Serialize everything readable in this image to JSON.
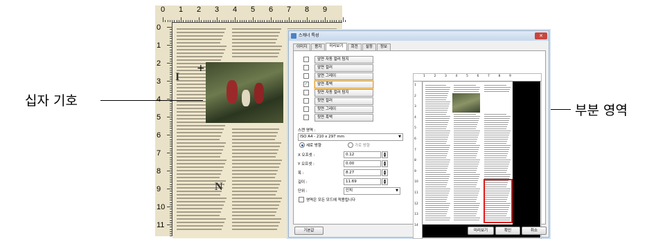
{
  "callouts": {
    "crosshair_label": "십자 기호",
    "region_label": "부분 영역"
  },
  "ruler": {
    "top_numbers": [
      "0",
      "1",
      "2",
      "3",
      "4",
      "5",
      "6",
      "7",
      "8",
      "9"
    ],
    "left_numbers": [
      "0",
      "1",
      "2",
      "3",
      "4",
      "5",
      "6",
      "7",
      "8",
      "9",
      "10",
      "11"
    ]
  },
  "dialog": {
    "title": "스캐너 특성",
    "close_label": "✕",
    "tabs": [
      "이미지",
      "용지",
      "미리보기",
      "회전",
      "설정",
      "정보"
    ],
    "active_tab": "미리보기",
    "options": [
      {
        "label": "앞면 자동 컬러 탐지",
        "checked": false
      },
      {
        "label": "앞면 컬러",
        "checked": false
      },
      {
        "label": "앞면 그레이",
        "checked": false
      },
      {
        "label": "앞면 흑백",
        "checked": true
      },
      {
        "label": "뒷면 자동 컬러 탐지",
        "checked": false
      },
      {
        "label": "뒷면 컬러",
        "checked": false
      },
      {
        "label": "뒷면 그레이",
        "checked": false
      },
      {
        "label": "뒷면 흑백",
        "checked": false
      }
    ],
    "scan_area_label": "스캔 영역 :",
    "scan_area_value": "ISO A4 - 210 x 297 mm",
    "orientation_portrait": "세로 방향",
    "orientation_landscape": "가로 방향",
    "x_label": "X 오프셋 :",
    "x_value": "0.12",
    "y_label": "Y 오프셋 :",
    "y_value": "0.00",
    "width_label": "폭 :",
    "width_value": "8.27",
    "length_label": "길이 :",
    "length_value": "11.69",
    "unit_label": "단위 :",
    "unit_value": "인치",
    "apply_all_label": "영역은 모든 모드에 적용됩니다",
    "preview_ruler_top": [
      "1",
      "2",
      "3",
      "4",
      "5",
      "6",
      "7",
      "8",
      "9"
    ],
    "preview_ruler_left": [
      "1",
      "2",
      "3",
      "4",
      "5",
      "6",
      "7",
      "8",
      "9",
      "10",
      "11",
      "12",
      "13",
      "14"
    ],
    "buttons": {
      "default": "기본값",
      "preview": "미리보기",
      "ok": "확인",
      "cancel": "취소"
    }
  },
  "colors": {
    "region_border": "#e01a1a",
    "selected_outline": "#e3a43a",
    "paper": "#efe7cd"
  }
}
